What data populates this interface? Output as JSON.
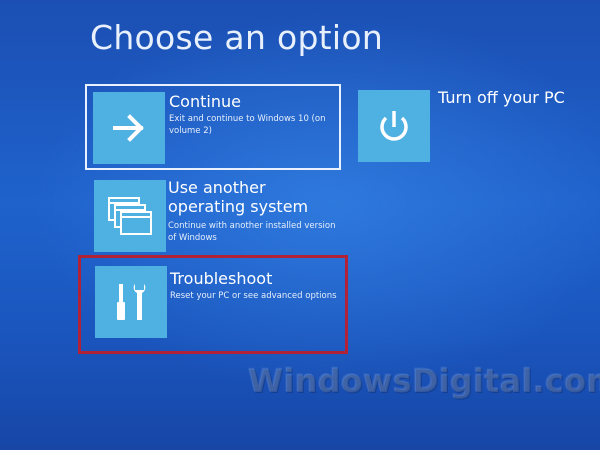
{
  "page": {
    "title": "Choose an option"
  },
  "options": {
    "continue": {
      "title": "Continue",
      "description": "Exit and continue to Windows 10 (on volume 2)",
      "icon": "arrow-right-icon"
    },
    "another_os": {
      "title": "Use another operating system",
      "title_line1": "Use another",
      "title_line2": "operating system",
      "description": "Continue with another installed version of Windows",
      "icon": "windows-stack-icon"
    },
    "troubleshoot": {
      "title": "Troubleshoot",
      "description": "Reset your PC or see advanced options",
      "icon": "tools-icon"
    },
    "turn_off": {
      "title": "Turn off your PC",
      "icon": "power-icon"
    }
  },
  "watermark": {
    "text": "WindowsDigital.com"
  },
  "colors": {
    "background": "#1f62cc",
    "tile_icon": "#4fb0e2",
    "highlight_border": "#b22236",
    "focus_border": "#e9f1ff"
  }
}
